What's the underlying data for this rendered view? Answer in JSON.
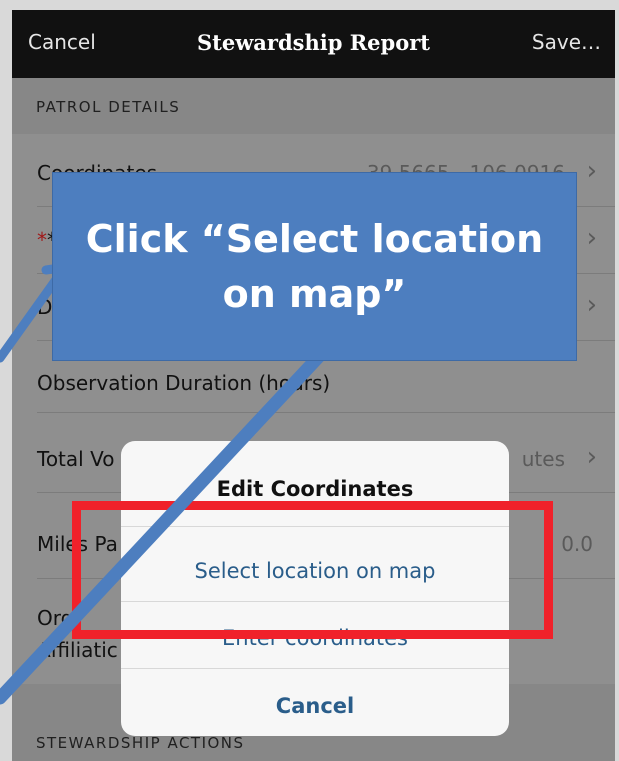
{
  "navbar": {
    "cancel": "Cancel",
    "title": "Stewardship Report",
    "save": "Save…"
  },
  "sections": {
    "patrol_details": "PATROL DETAILS",
    "stewardship_actions": "STEWARDSHIP ACTIONS"
  },
  "rows": {
    "coordinates": {
      "label": "Coordinates",
      "value": "39.5665, -106.0916"
    },
    "location": {
      "label": "*L"
    },
    "date": {
      "label": "D"
    },
    "observation": {
      "label": "Observation Duration (hours)"
    },
    "total_volunteer": {
      "label": "Total Vo",
      "value": "utes"
    },
    "miles": {
      "label": "Miles Pa",
      "value": "0.0"
    },
    "org": {
      "label": "Org",
      "label2": "Affiliatic"
    }
  },
  "modal": {
    "title": "Edit Coordinates",
    "select_location": "Select location on map",
    "enter_coordinates": "Enter coordinates",
    "cancel": "Cancel"
  },
  "callout": {
    "text": "Click “Select location on map”"
  },
  "colors": {
    "navbar": "#111111",
    "callout": "#4d7ebf",
    "highlight": "#f0212a",
    "link": "#2a5d8a"
  }
}
